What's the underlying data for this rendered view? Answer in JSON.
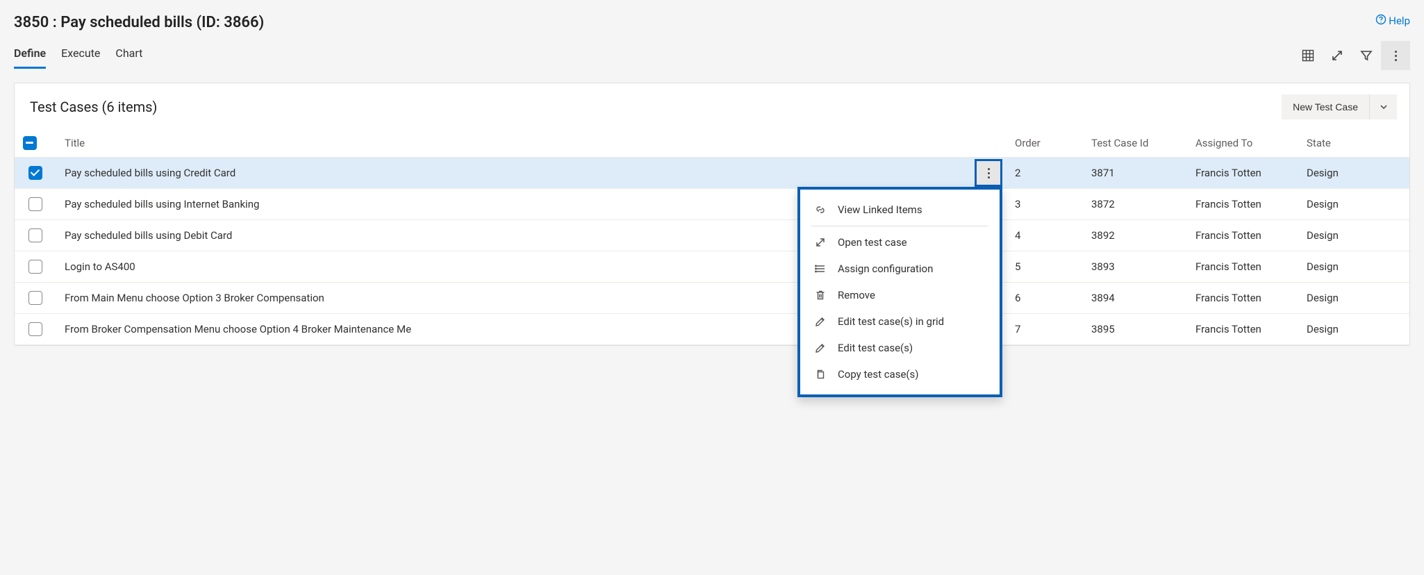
{
  "header": {
    "title": "3850 : Pay scheduled bills (ID: 3866)",
    "help_label": "Help"
  },
  "tabs": [
    {
      "label": "Define",
      "active": true
    },
    {
      "label": "Execute",
      "active": false
    },
    {
      "label": "Chart",
      "active": false
    }
  ],
  "panel": {
    "title": "Test Cases (6 items)",
    "new_button_label": "New Test Case"
  },
  "columns": {
    "title": "Title",
    "order": "Order",
    "id": "Test Case Id",
    "assigned": "Assigned To",
    "state": "State"
  },
  "rows": [
    {
      "selected": true,
      "title": "Pay scheduled bills using Credit Card",
      "order": "2",
      "id": "3871",
      "assigned": "Francis Totten",
      "state": "Design"
    },
    {
      "selected": false,
      "title": "Pay scheduled bills using Internet Banking",
      "order": "3",
      "id": "3872",
      "assigned": "Francis Totten",
      "state": "Design"
    },
    {
      "selected": false,
      "title": "Pay scheduled bills using Debit Card",
      "order": "4",
      "id": "3892",
      "assigned": "Francis Totten",
      "state": "Design"
    },
    {
      "selected": false,
      "title": "Login to AS400",
      "order": "5",
      "id": "3893",
      "assigned": "Francis Totten",
      "state": "Design"
    },
    {
      "selected": false,
      "title": "From Main Menu choose Option 3 Broker Compensation",
      "order": "6",
      "id": "3894",
      "assigned": "Francis Totten",
      "state": "Design"
    },
    {
      "selected": false,
      "title": "From Broker Compensation Menu choose Option 4 Broker Maintenance Me",
      "order": "7",
      "id": "3895",
      "assigned": "Francis Totten",
      "state": "Design"
    }
  ],
  "context_menu": [
    {
      "icon": "link",
      "label": "View Linked Items",
      "sep_after": true
    },
    {
      "icon": "open",
      "label": "Open test case"
    },
    {
      "icon": "config",
      "label": "Assign configuration"
    },
    {
      "icon": "trash",
      "label": "Remove"
    },
    {
      "icon": "edit",
      "label": "Edit test case(s) in grid"
    },
    {
      "icon": "edit",
      "label": "Edit test case(s)"
    },
    {
      "icon": "copy",
      "label": "Copy test case(s)"
    }
  ]
}
